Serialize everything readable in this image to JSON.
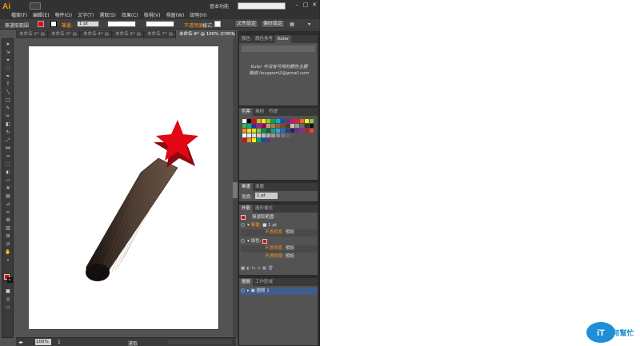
{
  "app": {
    "logo": "Ai",
    "workspace": "基本功能"
  },
  "menu": [
    "檔案(F)",
    "編輯(E)",
    "物件(O)",
    "文字(T)",
    "選取(S)",
    "效果(C)",
    "檢視(V)",
    "視窗(W)",
    "說明(H)"
  ],
  "control": {
    "selection_label": "無選取範圍",
    "stroke_label": "筆畫:",
    "stroke_value": "1 pt",
    "opacity_label": "不透明度:",
    "style_label": "樣式:",
    "doc_setup": "文件設定",
    "prefs": "偏好設定"
  },
  "tabs": [
    "未命名-2* @...",
    "未命名-3* @...",
    "未命名-4* @...",
    "未命名-5* @...",
    "未命名-7* @...",
    "未命名-8* @ 100% (CMYK/預覽)"
  ],
  "status": {
    "zoom": "100%",
    "page": "1",
    "mode": "選取"
  },
  "panels": {
    "color_tabs": [
      "顏色",
      "顏色參考",
      "Kuler"
    ],
    "kuler_message": "Kuler 中沒有可用的顏色主題",
    "kuler_contact": "聯絡 itsupport2@gmail.com",
    "swatch_tabs": [
      "色票",
      "筆刷",
      "符號"
    ],
    "stroke_tabs": [
      "筆畫",
      "漸層"
    ],
    "stroke_weight_label": "寬度:",
    "stroke_weight_value": "1 pt",
    "appearance_tabs": [
      "外觀",
      "圖形樣式"
    ],
    "appearance": {
      "title": "無選取範圍",
      "stroke_label": "筆畫:",
      "stroke_value": "1 pt",
      "opacity1": "不透明度:",
      "opacity1_value": "預設",
      "fill_label": "填色:",
      "opacity2": "不透明度:",
      "opacity2_value": "預設",
      "opacity3": "不透明度:",
      "opacity3_value": "預設"
    },
    "layers_tabs": [
      "圖層",
      "工作區域"
    ],
    "layer_name": "圖層 1"
  },
  "colors": {
    "fill": "#e30613",
    "star": "#e30613",
    "star_side": "#8a0a10",
    "ui_bg": "#535353"
  },
  "watermark": "iT邦幫忙"
}
